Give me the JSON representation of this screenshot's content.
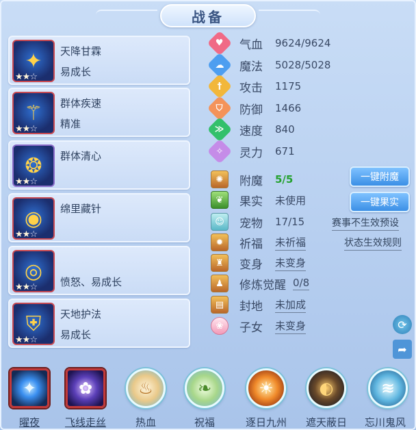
{
  "title": "战备",
  "equipment": [
    {
      "name": "天降甘霖",
      "attr": "易成长",
      "stars_on": 2,
      "stars_total": 3
    },
    {
      "name": "群体疾速",
      "attr": "精准",
      "stars_on": 2,
      "stars_total": 3
    },
    {
      "name": "群体清心",
      "attr": "",
      "stars_on": 2,
      "stars_total": 3
    },
    {
      "name": "绵里藏针",
      "attr": "",
      "stars_on": 2,
      "stars_total": 3
    },
    {
      "name": "",
      "attr": "愤怒、易成长",
      "stars_on": 2,
      "stars_total": 3
    },
    {
      "name": "天地护法",
      "attr": "易成长",
      "stars_on": 2,
      "stars_total": 3
    }
  ],
  "stats": [
    {
      "label": "气血",
      "value": "9624/9624",
      "icon": "heart-icon",
      "color": "#f06a86"
    },
    {
      "label": "魔法",
      "value": "5028/5028",
      "icon": "mana-icon",
      "color": "#4d9ef0"
    },
    {
      "label": "攻击",
      "value": "1175",
      "icon": "sword-icon",
      "color": "#f2b73b"
    },
    {
      "label": "防御",
      "value": "1466",
      "icon": "shield-icon",
      "color": "#f4935a"
    },
    {
      "label": "速度",
      "value": "840",
      "icon": "speed-icon",
      "color": "#33c06b"
    },
    {
      "label": "灵力",
      "value": "671",
      "icon": "spirit-icon",
      "color": "#c58ce8"
    }
  ],
  "aux": [
    {
      "label": "附魔",
      "value": "5/5",
      "style": "green",
      "icon": "enchant-icon"
    },
    {
      "label": "果实",
      "value": "未使用",
      "style": "plain",
      "icon": "fruit-icon"
    },
    {
      "label": "宠物",
      "value": "17/15",
      "style": "plain",
      "icon": "pet-icon"
    },
    {
      "label": "祈福",
      "value": "未祈福",
      "style": "link",
      "icon": "blessing-icon"
    },
    {
      "label": "变身",
      "value": "未变身",
      "style": "link",
      "icon": "transform-icon"
    },
    {
      "label": "修炼觉醒",
      "value": "0/8",
      "style": "link",
      "icon": "cultivate-icon"
    },
    {
      "label": "封地",
      "value": "未加成",
      "style": "link",
      "icon": "fief-icon"
    },
    {
      "label": "子女",
      "value": "未变身",
      "style": "link",
      "icon": "child-icon"
    }
  ],
  "buttons": {
    "enchant_all": "一键附魔",
    "fruit_all": "一键果实"
  },
  "links": {
    "event_preset": "赛事不生效预设",
    "status_rules": "状态生效规则"
  },
  "skills": [
    {
      "label": "曜夜",
      "icon": "night-orb-icon",
      "color": "#3a8ff0"
    },
    {
      "label": "飞线走丝",
      "icon": "silk-thread-icon",
      "color": "#5b3fb8"
    },
    {
      "label": "热血",
      "icon": "hot-blood-icon",
      "color": "#e9c98a"
    },
    {
      "label": "祝福",
      "icon": "blessing-orb-icon",
      "color": "#a8d78a"
    },
    {
      "label": "逐日九州",
      "icon": "chase-sun-icon",
      "color": "#f08a2a"
    },
    {
      "label": "遮天蔽日",
      "icon": "eclipse-icon",
      "color": "#4a3a2a"
    },
    {
      "label": "忘川鬼风",
      "icon": "ghost-wind-icon",
      "color": "#5fb6e0"
    }
  ]
}
